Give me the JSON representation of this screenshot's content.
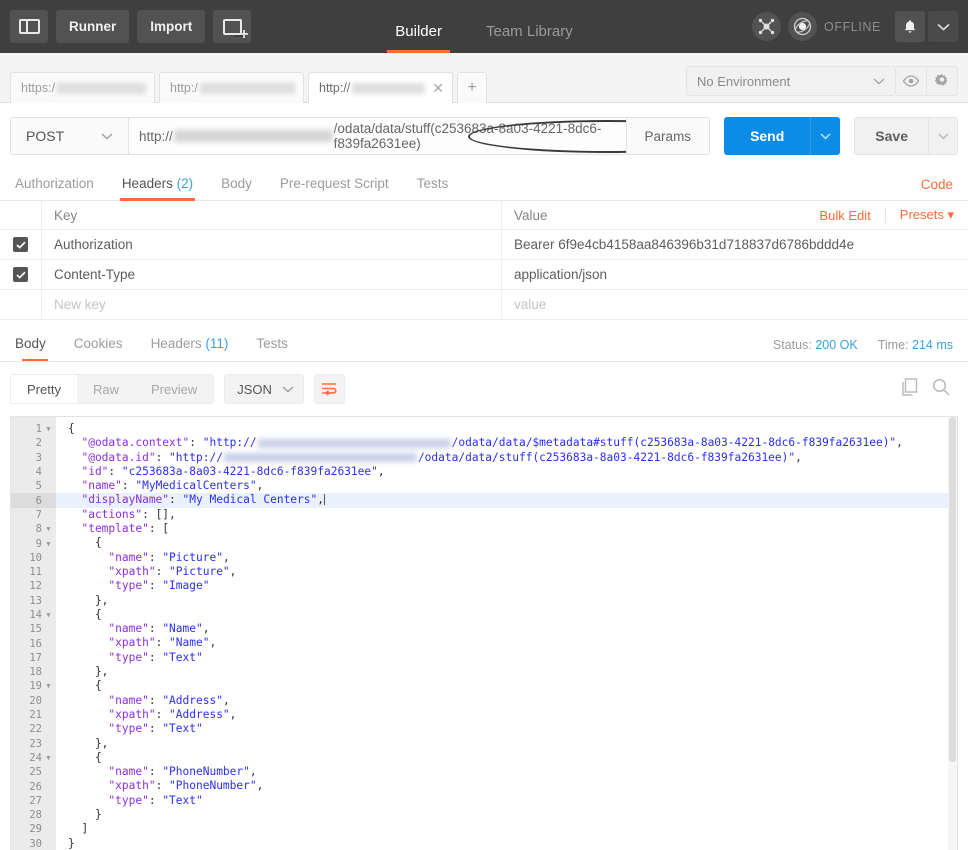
{
  "topbar": {
    "sidebar_toggle": "sidebar-toggle",
    "runner_label": "Runner",
    "import_label": "Import",
    "new_tab_label": "new-window",
    "center_tabs": [
      {
        "label": "Builder",
        "active": true
      },
      {
        "label": "Team Library",
        "active": false
      }
    ],
    "sync_icon": "network-icon",
    "status_icon": "orbit-icon",
    "status_label": "OFFLINE",
    "bell_icon": "bell-icon",
    "chevron_icon": "chevron-down-icon"
  },
  "tabstrip": {
    "tabs": [
      {
        "prefix": "https:/",
        "redacted": true,
        "active": false,
        "closable": false
      },
      {
        "prefix": "http:/",
        "redacted": true,
        "active": false,
        "closable": false
      },
      {
        "prefix": "http://",
        "redacted": true,
        "active": true,
        "closable": true
      }
    ],
    "new_tab": "+",
    "environment": "No Environment",
    "eye_icon": "eye-icon",
    "gear_icon": "gear-icon"
  },
  "urlbar": {
    "method": "POST",
    "url_prefix": "http://",
    "url_suffix": "/odata/data/stuff(c253683a-8a03-4221-8dc6-f839fa2631ee)",
    "highlighted_part": "/stuff(c253683a-8a03-4221-8dc6-f839fa2631ee)",
    "params_label": "Params",
    "send_label": "Send",
    "save_label": "Save",
    "send_color": "#0d8ce6"
  },
  "request_tabs": {
    "items": [
      {
        "label": "Authorization",
        "count": "",
        "active": false
      },
      {
        "label": "Headers",
        "count": "(2)",
        "active": true
      },
      {
        "label": "Body",
        "count": "",
        "active": false
      },
      {
        "label": "Pre-request Script",
        "count": "",
        "active": false
      },
      {
        "label": "Tests",
        "count": "",
        "active": false
      }
    ],
    "code_label": "Code"
  },
  "headers_table": {
    "col_key": "Key",
    "col_value": "Value",
    "bulk_edit_label": "Bulk Edit",
    "presets_label": "Presets",
    "rows": [
      {
        "checked": true,
        "key": "Authorization",
        "value": "Bearer 6f9e4cb4158aa846396b31d718837d6786bddd4e"
      },
      {
        "checked": true,
        "key": "Content-Type",
        "value": "application/json"
      }
    ],
    "new_row": {
      "key_placeholder": "New key",
      "value_placeholder": "value"
    }
  },
  "response": {
    "tabs": [
      {
        "label": "Body",
        "count": "",
        "active": true
      },
      {
        "label": "Cookies",
        "count": "",
        "active": false
      },
      {
        "label": "Headers",
        "count": "(11)",
        "active": false
      },
      {
        "label": "Tests",
        "count": "",
        "active": false
      }
    ],
    "status_label": "Status:",
    "status_value": "200 OK",
    "time_label": "Time:",
    "time_value": "214 ms",
    "view_modes": [
      {
        "label": "Pretty",
        "active": true
      },
      {
        "label": "Raw",
        "active": false
      },
      {
        "label": "Preview",
        "active": false
      }
    ],
    "language": "JSON",
    "wrap_icon": "word-wrap-icon",
    "copy_icon": "copy-icon",
    "search_icon": "search-icon"
  },
  "editor": {
    "highlight_line": 6,
    "fold_lines": [
      1,
      8,
      9,
      14,
      19,
      24
    ],
    "lines": [
      {
        "n": 1,
        "segments": [
          {
            "t": "p",
            "v": "{"
          }
        ]
      },
      {
        "n": 2,
        "segments": [
          {
            "t": "key",
            "v": "  \"@odata.context\""
          },
          {
            "t": "p",
            "v": ": "
          },
          {
            "t": "str",
            "v": "\"http://"
          },
          {
            "t": "blur",
            "v": ""
          },
          {
            "t": "str",
            "v": "/odata/data/$metadata#stuff(c253683a-8a03-4221-8dc6-f839fa2631ee)\""
          },
          {
            "t": "p",
            "v": ","
          }
        ]
      },
      {
        "n": 3,
        "segments": [
          {
            "t": "key",
            "v": "  \"@odata.id\""
          },
          {
            "t": "p",
            "v": ": "
          },
          {
            "t": "str",
            "v": "\"http://"
          },
          {
            "t": "blur",
            "v": ""
          },
          {
            "t": "str",
            "v": "/odata/data/stuff(c253683a-8a03-4221-8dc6-f839fa2631ee)\""
          },
          {
            "t": "p",
            "v": ","
          }
        ]
      },
      {
        "n": 4,
        "segments": [
          {
            "t": "key",
            "v": "  \"id\""
          },
          {
            "t": "p",
            "v": ": "
          },
          {
            "t": "str",
            "v": "\"c253683a-8a03-4221-8dc6-f839fa2631ee\""
          },
          {
            "t": "p",
            "v": ","
          }
        ]
      },
      {
        "n": 5,
        "segments": [
          {
            "t": "key",
            "v": "  \"name\""
          },
          {
            "t": "p",
            "v": ": "
          },
          {
            "t": "str",
            "v": "\"MyMedicalCenters\""
          },
          {
            "t": "p",
            "v": ","
          }
        ]
      },
      {
        "n": 6,
        "segments": [
          {
            "t": "key",
            "v": "  \"displayName\""
          },
          {
            "t": "p",
            "v": ": "
          },
          {
            "t": "str",
            "v": "\"My Medical Centers\""
          },
          {
            "t": "p",
            "v": ","
          },
          {
            "t": "caret",
            "v": ""
          }
        ]
      },
      {
        "n": 7,
        "segments": [
          {
            "t": "key",
            "v": "  \"actions\""
          },
          {
            "t": "p",
            "v": ": [],"
          }
        ]
      },
      {
        "n": 8,
        "segments": [
          {
            "t": "key",
            "v": "  \"template\""
          },
          {
            "t": "p",
            "v": ": ["
          }
        ]
      },
      {
        "n": 9,
        "segments": [
          {
            "t": "p",
            "v": "    {"
          }
        ]
      },
      {
        "n": 10,
        "segments": [
          {
            "t": "key",
            "v": "      \"name\""
          },
          {
            "t": "p",
            "v": ": "
          },
          {
            "t": "str",
            "v": "\"Picture\""
          },
          {
            "t": "p",
            "v": ","
          }
        ]
      },
      {
        "n": 11,
        "segments": [
          {
            "t": "key",
            "v": "      \"xpath\""
          },
          {
            "t": "p",
            "v": ": "
          },
          {
            "t": "str",
            "v": "\"Picture\""
          },
          {
            "t": "p",
            "v": ","
          }
        ]
      },
      {
        "n": 12,
        "segments": [
          {
            "t": "key",
            "v": "      \"type\""
          },
          {
            "t": "p",
            "v": ": "
          },
          {
            "t": "str",
            "v": "\"Image\""
          }
        ]
      },
      {
        "n": 13,
        "segments": [
          {
            "t": "p",
            "v": "    },"
          }
        ]
      },
      {
        "n": 14,
        "segments": [
          {
            "t": "p",
            "v": "    {"
          }
        ]
      },
      {
        "n": 15,
        "segments": [
          {
            "t": "key",
            "v": "      \"name\""
          },
          {
            "t": "p",
            "v": ": "
          },
          {
            "t": "str",
            "v": "\"Name\""
          },
          {
            "t": "p",
            "v": ","
          }
        ]
      },
      {
        "n": 16,
        "segments": [
          {
            "t": "key",
            "v": "      \"xpath\""
          },
          {
            "t": "p",
            "v": ": "
          },
          {
            "t": "str",
            "v": "\"Name\""
          },
          {
            "t": "p",
            "v": ","
          }
        ]
      },
      {
        "n": 17,
        "segments": [
          {
            "t": "key",
            "v": "      \"type\""
          },
          {
            "t": "p",
            "v": ": "
          },
          {
            "t": "str",
            "v": "\"Text\""
          }
        ]
      },
      {
        "n": 18,
        "segments": [
          {
            "t": "p",
            "v": "    },"
          }
        ]
      },
      {
        "n": 19,
        "segments": [
          {
            "t": "p",
            "v": "    {"
          }
        ]
      },
      {
        "n": 20,
        "segments": [
          {
            "t": "key",
            "v": "      \"name\""
          },
          {
            "t": "p",
            "v": ": "
          },
          {
            "t": "str",
            "v": "\"Address\""
          },
          {
            "t": "p",
            "v": ","
          }
        ]
      },
      {
        "n": 21,
        "segments": [
          {
            "t": "key",
            "v": "      \"xpath\""
          },
          {
            "t": "p",
            "v": ": "
          },
          {
            "t": "str",
            "v": "\"Address\""
          },
          {
            "t": "p",
            "v": ","
          }
        ]
      },
      {
        "n": 22,
        "segments": [
          {
            "t": "key",
            "v": "      \"type\""
          },
          {
            "t": "p",
            "v": ": "
          },
          {
            "t": "str",
            "v": "\"Text\""
          }
        ]
      },
      {
        "n": 23,
        "segments": [
          {
            "t": "p",
            "v": "    },"
          }
        ]
      },
      {
        "n": 24,
        "segments": [
          {
            "t": "p",
            "v": "    {"
          }
        ]
      },
      {
        "n": 25,
        "segments": [
          {
            "t": "key",
            "v": "      \"name\""
          },
          {
            "t": "p",
            "v": ": "
          },
          {
            "t": "str",
            "v": "\"PhoneNumber\""
          },
          {
            "t": "p",
            "v": ","
          }
        ]
      },
      {
        "n": 26,
        "segments": [
          {
            "t": "key",
            "v": "      \"xpath\""
          },
          {
            "t": "p",
            "v": ": "
          },
          {
            "t": "str",
            "v": "\"PhoneNumber\""
          },
          {
            "t": "p",
            "v": ","
          }
        ]
      },
      {
        "n": 27,
        "segments": [
          {
            "t": "key",
            "v": "      \"type\""
          },
          {
            "t": "p",
            "v": ": "
          },
          {
            "t": "str",
            "v": "\"Text\""
          }
        ]
      },
      {
        "n": 28,
        "segments": [
          {
            "t": "p",
            "v": "    }"
          }
        ]
      },
      {
        "n": 29,
        "segments": [
          {
            "t": "p",
            "v": "  ]"
          }
        ]
      },
      {
        "n": 30,
        "segments": [
          {
            "t": "p",
            "v": "}"
          }
        ]
      }
    ]
  },
  "colors": {
    "accent_orange": "#ff6c37",
    "send_blue": "#0d8ce6",
    "link_blue": "#3aa0e0",
    "header_dark": "#3f3f3f"
  }
}
